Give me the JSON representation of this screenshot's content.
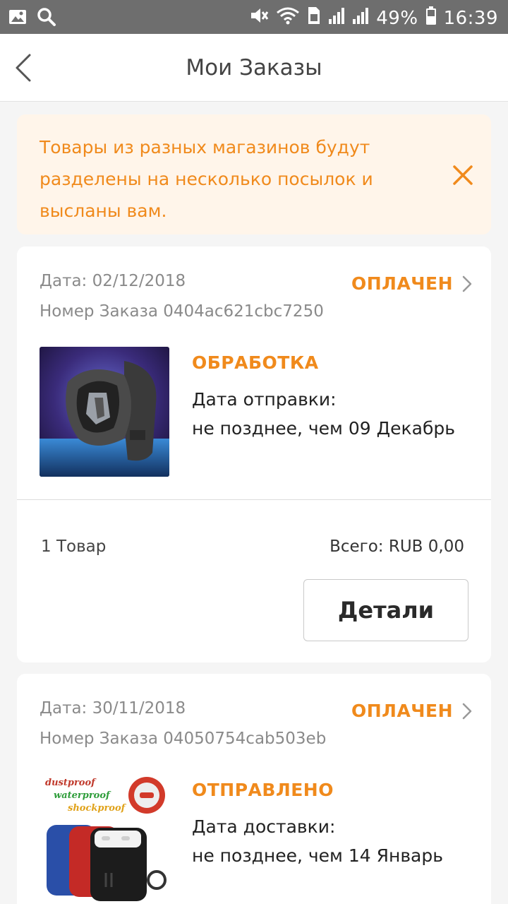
{
  "status_bar": {
    "battery": "49%",
    "time": "16:39",
    "icons": [
      "image-icon",
      "search-icon",
      "mute-icon",
      "wifi-icon",
      "sim-icon",
      "signal-icon",
      "signal-icon",
      "battery-icon"
    ]
  },
  "app_bar": {
    "title": "Мои Заказы",
    "back_icon": "chevron-left-icon"
  },
  "notice": {
    "text": "Товары из разных магазинов будут разделены на несколько посылок и высланы вам.",
    "close_icon": "close-icon"
  },
  "orders": [
    {
      "date": "Дата: 02/12/2018",
      "number": "Номер Заказа 0404ac621cbc7250",
      "status": "ОПЛАЧЕН",
      "stage": "ОБРАБОТКА",
      "date_label": "Дата отправки:",
      "date_value": "не позднее, чем 09 Декабрь",
      "count": "1 Товар",
      "total": "Всего: RUB 0,00",
      "details_label": "Детали"
    },
    {
      "date": "Дата: 30/11/2018",
      "number": "Номер Заказа 04050754cab503eb",
      "status": "ОПЛАЧЕН",
      "stage": "ОТПРАВЛЕНО",
      "date_label": "Дата доставки:",
      "date_value": "не позднее, чем 14 Январь",
      "image_text": [
        "dustproof",
        "waterproof",
        "shockproof"
      ]
    }
  ],
  "colors": {
    "accent": "#f08a1c",
    "notice_bg": "#fff5ea",
    "status_bar": "#6e6e6e",
    "page_bg": "#f5f5f5"
  }
}
